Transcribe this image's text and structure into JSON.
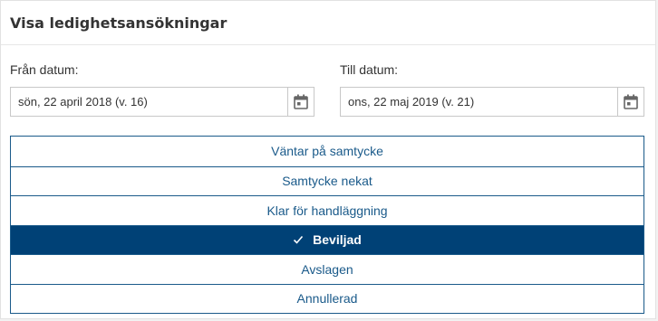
{
  "header": {
    "title": "Visa ledighetsansökningar"
  },
  "from": {
    "label": "Från datum:",
    "value": "sön, 22 april 2018 (v. 16)",
    "icon": "calendar-icon"
  },
  "to": {
    "label": "Till datum:",
    "value": "ons, 22 maj 2019 (v. 21)",
    "icon": "calendar-icon"
  },
  "statuses": [
    {
      "label": "Väntar på samtycke",
      "selected": false
    },
    {
      "label": "Samtycke nekat",
      "selected": false
    },
    {
      "label": "Klar för handläggning",
      "selected": false
    },
    {
      "label": "Beviljad",
      "selected": true
    },
    {
      "label": "Avslagen",
      "selected": false
    },
    {
      "label": "Annullerad",
      "selected": false
    }
  ],
  "colors": {
    "accent": "#004176",
    "accent_text": "#1a5a8a",
    "icon_gray": "#666666"
  }
}
